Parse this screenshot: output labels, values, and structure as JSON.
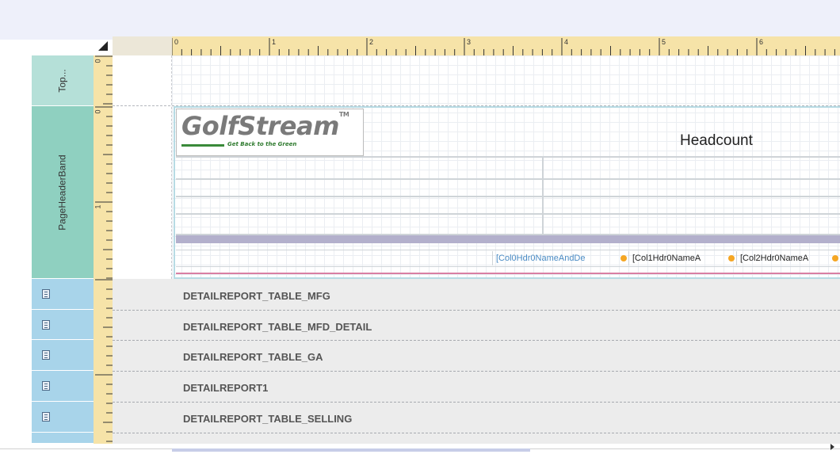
{
  "ruler": {
    "labels": [
      "0",
      "1",
      "2",
      "3",
      "4",
      "5",
      "6"
    ],
    "vertical_top": "0",
    "vertical_page_header": [
      "0",
      "1"
    ]
  },
  "bands": {
    "top_margin": "Top...",
    "page_header": "PageHeaderBand"
  },
  "page_header": {
    "logo": {
      "main": "GolfStream",
      "tm": "TM",
      "tagline": "Get Back to the Green"
    },
    "title": "Headcount",
    "columns": [
      {
        "text": "[Col0Hdr0NameAndDe",
        "color": "#4a8bc4"
      },
      {
        "text": "[Col1Hdr0NameA",
        "color": "#222222"
      },
      {
        "text": "[Col2Hdr0NameA",
        "color": "#222222"
      }
    ]
  },
  "detail_reports": [
    "DETAILREPORT_TABLE_MFG",
    "DETAILREPORT_TABLE_MFD_DETAIL",
    "DETAILREPORT_TABLE_GA",
    "DETAILREPORT1",
    "DETAILREPORT_TABLE_SELLING"
  ],
  "colors": {
    "band_top": "#b5e0d8",
    "band_page_header": "#8fd0c0",
    "band_detail": "#a8d4ea",
    "ruler": "#f6e3a8",
    "header_border": "#b7dbe4",
    "purple_bar": "#b3b0cc",
    "pink_line": "#d97fa3"
  }
}
